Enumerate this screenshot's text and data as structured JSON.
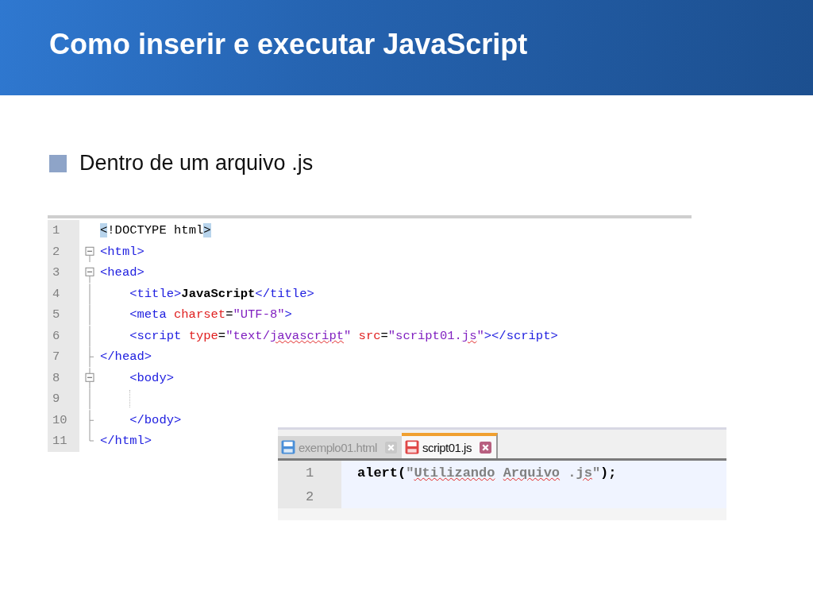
{
  "slide": {
    "title": "Como inserir e executar JavaScript",
    "bullets": [
      "Dentro de um arquivo .js"
    ]
  },
  "html_editor": {
    "lines": [
      {
        "number": "1",
        "kind": "plain",
        "indent": false,
        "tokens": [
          {
            "kind": "match",
            "text": "<"
          },
          {
            "kind": "plain",
            "text": "!DOCTYPE html"
          },
          {
            "kind": "match",
            "text": ">"
          }
        ]
      },
      {
        "number": "2",
        "kind": "fold-start",
        "indent": false,
        "tokens": [
          {
            "kind": "tag",
            "text": "<html>"
          }
        ]
      },
      {
        "number": "3",
        "kind": "fold-start",
        "indent": false,
        "tokens": [
          {
            "kind": "tag",
            "text": "<head>"
          }
        ]
      },
      {
        "number": "4",
        "kind": "fold-line",
        "indent": true,
        "tokens": [
          {
            "kind": "tag",
            "text": "<title>"
          },
          {
            "kind": "bold",
            "text": "JavaScript"
          },
          {
            "kind": "tag",
            "text": "</title>"
          }
        ]
      },
      {
        "number": "5",
        "kind": "fold-line",
        "indent": true,
        "tokens": [
          {
            "kind": "tag",
            "text": "<meta "
          },
          {
            "kind": "attr",
            "text": "charset"
          },
          {
            "kind": "plain",
            "text": "="
          },
          {
            "kind": "value",
            "text": "\"UTF-8\""
          },
          {
            "kind": "tag",
            "text": ">"
          }
        ]
      },
      {
        "number": "6",
        "kind": "fold-line",
        "indent": true,
        "tokens": [
          {
            "kind": "tag",
            "text": "<script "
          },
          {
            "kind": "attr",
            "text": "type"
          },
          {
            "kind": "plain",
            "text": "="
          },
          {
            "kind": "value",
            "text": "\"text/"
          },
          {
            "kind": "misspelled",
            "text": "javascript"
          },
          {
            "kind": "value",
            "text": "\" "
          },
          {
            "kind": "attr",
            "text": "src"
          },
          {
            "kind": "plain",
            "text": "="
          },
          {
            "kind": "value",
            "text": "\"script01."
          },
          {
            "kind": "misspelled",
            "text": "js"
          },
          {
            "kind": "value",
            "text": "\""
          },
          {
            "kind": "tag",
            "text": "></script>"
          }
        ]
      },
      {
        "number": "7",
        "kind": "fold-end",
        "indent": false,
        "tokens": [
          {
            "kind": "tag",
            "text": "</head>"
          }
        ]
      },
      {
        "number": "8",
        "kind": "fold-start",
        "indent": true,
        "tokens": [
          {
            "kind": "tag",
            "text": "<body>"
          }
        ]
      },
      {
        "number": "9",
        "kind": "fold-line",
        "indent": true
      },
      {
        "number": "10",
        "kind": "fold-end",
        "indent": true,
        "tokens": [
          {
            "kind": "tag",
            "text": "</body>"
          }
        ]
      },
      {
        "number": "11",
        "kind": "fold-last",
        "indent": false,
        "tokens": [
          {
            "kind": "tag",
            "text": "</html>"
          }
        ]
      }
    ]
  },
  "js_editor": {
    "tabs": [
      {
        "label": "exemplo01.html",
        "selected": false,
        "modified": false
      },
      {
        "label": "script01.js",
        "selected": true,
        "modified": true
      }
    ],
    "lines": [
      {
        "number": "1",
        "tokens": [
          {
            "kind": "bold",
            "text": "alert("
          },
          {
            "kind": "string",
            "text": "\""
          },
          {
            "kind": "misspelled-string",
            "text": "Utilizando "
          },
          {
            "kind": "misspelled-string",
            "text": "Arquivo"
          },
          {
            "kind": "string",
            "text": " ."
          },
          {
            "kind": "misspelled-string",
            "text": "js"
          },
          {
            "kind": "string",
            "text": "\""
          },
          {
            "kind": "bold",
            "text": ");"
          }
        ]
      },
      {
        "number": "2"
      }
    ]
  }
}
